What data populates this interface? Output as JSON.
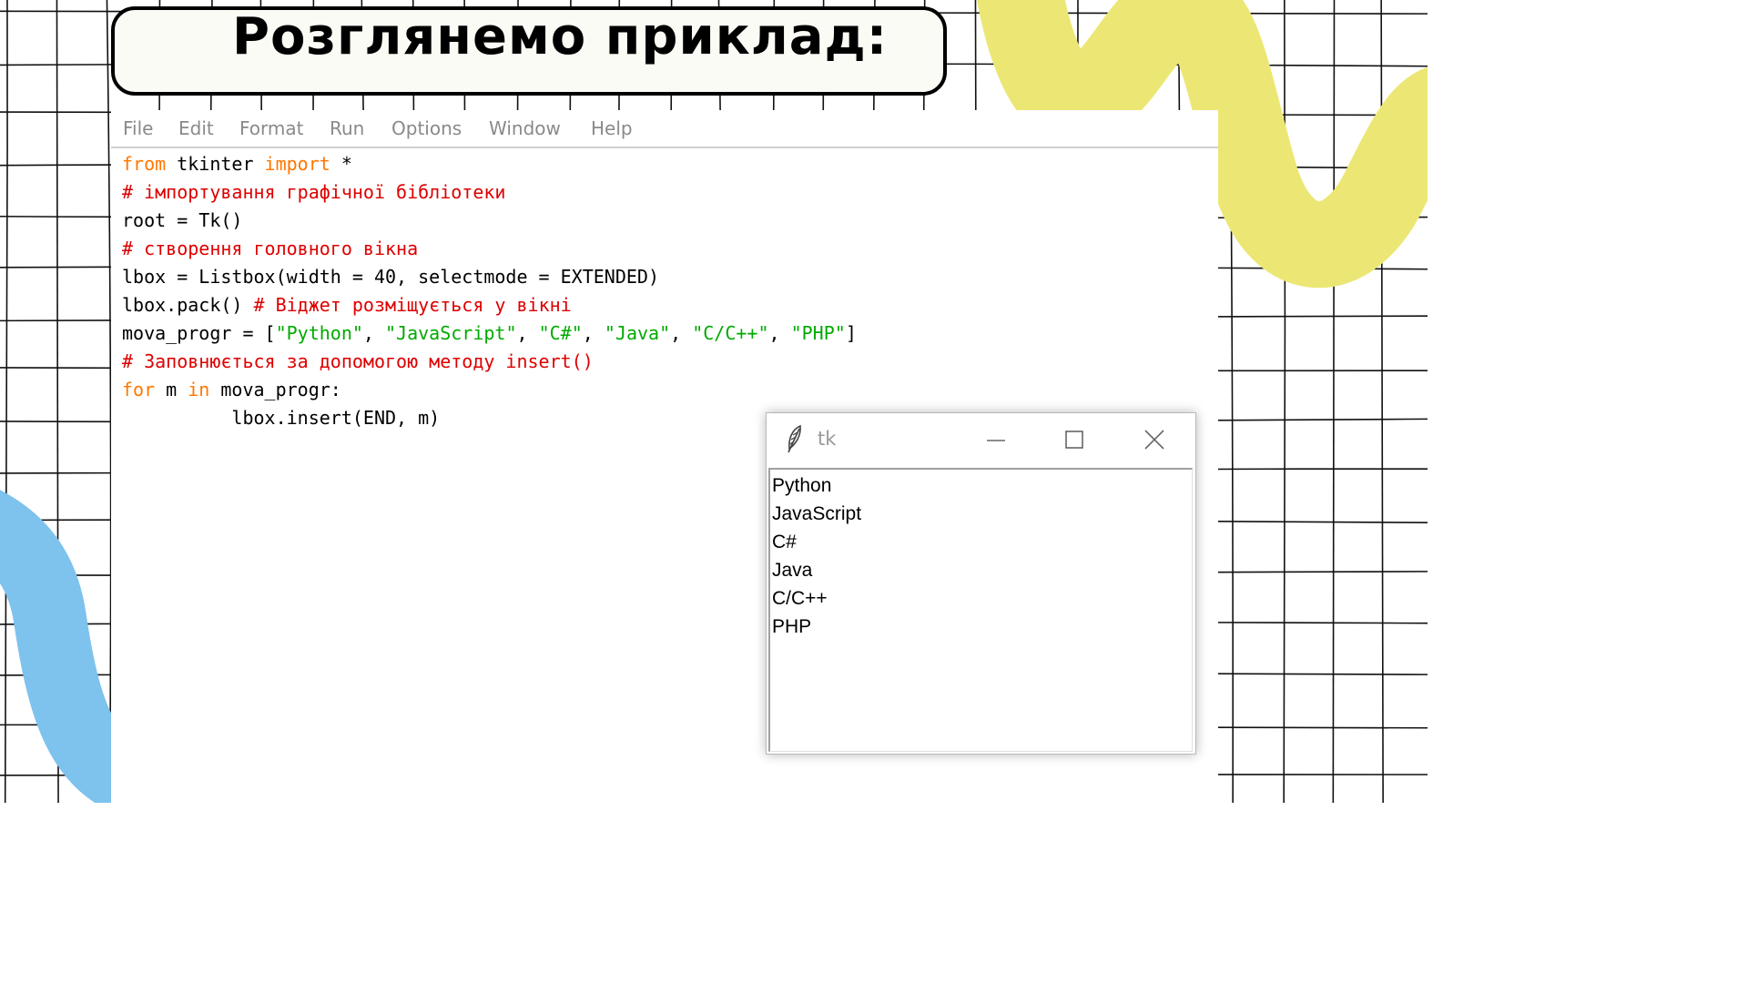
{
  "slide": {
    "title": "Розглянемо приклад:",
    "colors": {
      "accent_yellow": "#ece774",
      "accent_blue": "#7ec2ee",
      "grid": "#111111"
    }
  },
  "editor": {
    "menu": [
      "File",
      "Edit",
      "Format",
      "Run",
      "Options",
      "Window",
      "Help"
    ],
    "code": {
      "l1_kw1": "from",
      "l1_mid": " tkinter ",
      "l1_kw2": "import",
      "l1_end": " *",
      "l2_comment": "# імпортування графічної бібліотеки",
      "l3": "root = Tk()",
      "l4_comment": "# створення головного вікна",
      "l5": "lbox = Listbox(width = 40, selectmode = EXTENDED)",
      "l6_code": "lbox.pack() ",
      "l6_comment": "# Віджет розміщується у вікні",
      "l7_start": "mova_progr = [",
      "l7_s1": "\"Python\"",
      "l7_s2": "\"JavaScript\"",
      "l7_s3": "\"C#\"",
      "l7_s4": "\"Java\"",
      "l7_s5": "\"C/C++\"",
      "l7_s6": "\"PHP\"",
      "l7_sep": ", ",
      "l7_end": "]",
      "l8_comment": "# Заповнюється за допомогою методу insert()",
      "l9_kw1": "for",
      "l9_mid1": " m ",
      "l9_kw2": "in",
      "l9_end": " mova_progr:",
      "l10": "          lbox.insert(END, m)"
    },
    "colors": {
      "keyword": "#ff7700",
      "comment": "#dd0000",
      "string": "#00aa00"
    }
  },
  "tk_window": {
    "title": "tk",
    "icons": {
      "app": "feather-icon",
      "minimize": "minimize-icon",
      "maximize": "maximize-icon",
      "close": "close-icon"
    },
    "listbox_items": [
      "Python",
      "JavaScript",
      "C#",
      "Java",
      "C/C++",
      "PHP"
    ]
  }
}
